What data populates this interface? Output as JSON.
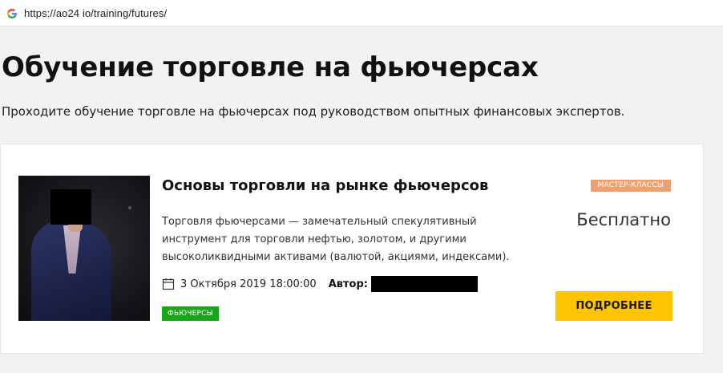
{
  "browser": {
    "url": "https://ao24 io/training/futures/",
    "favicon_icon": "google-g-icon"
  },
  "page": {
    "title": "Обучение торговле на фьючерсах",
    "subtitle": "Проходите обучение торговле на фьючерсах под руководством опытных финансовых экспертов."
  },
  "course": {
    "title": "Основы торговли на рынке фьючерсов",
    "description": "Торговля фьючерсами — замечательный спекулятивный инструмент для торговли нефтью, золотом, и другими высоколиквидными активами (валютой, акциями, индексами).",
    "date": "3 Октября 2019 18:00:00",
    "author_label": "Автор:",
    "author_name_redacted": true,
    "category_tag": "ФЬЮЧЕРСЫ",
    "type_tag": "МАСТЕР-КЛАССЫ",
    "price": "Бесплатно",
    "details_button": "ПОДРОБНЕЕ",
    "photo_icon": "presenter-photo",
    "date_icon": "calendar-icon"
  },
  "colors": {
    "accent_button": "#ffc400",
    "tag_green": "#1aa61a",
    "tag_orange": "#f0a06e",
    "page_background": "#f2f2f2"
  }
}
